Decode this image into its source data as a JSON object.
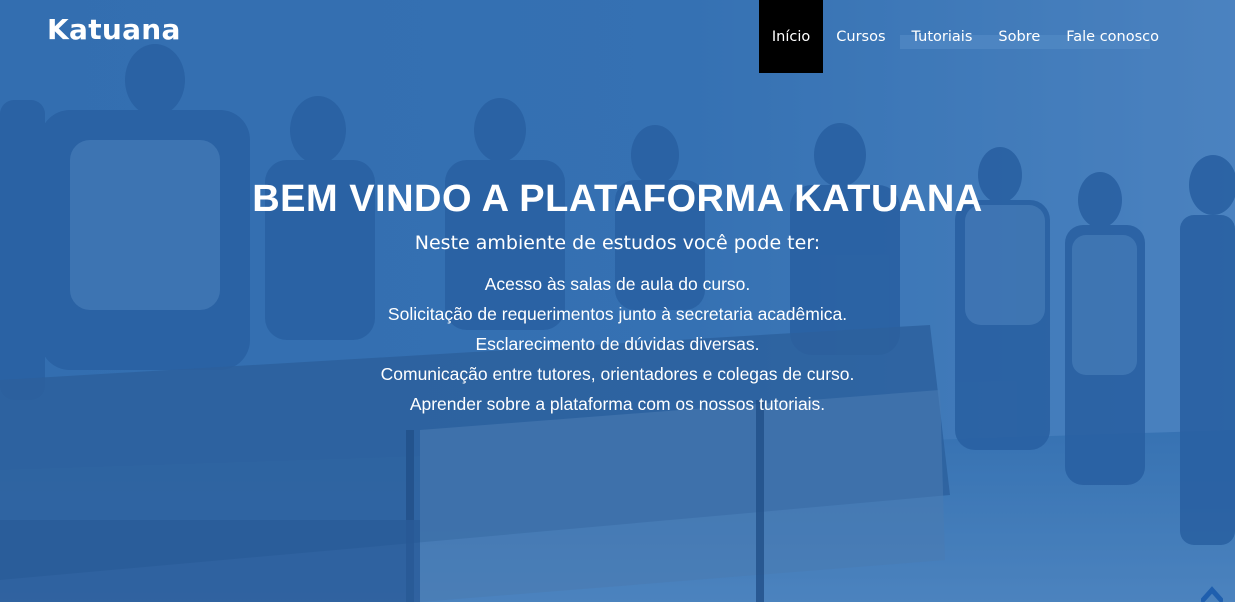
{
  "brand": "Katuana",
  "nav": [
    {
      "label": "Início",
      "active": true
    },
    {
      "label": "Cursos",
      "active": false
    },
    {
      "label": "Tutoriais",
      "active": false
    },
    {
      "label": "Sobre",
      "active": false
    },
    {
      "label": "Fale conosco",
      "active": false
    }
  ],
  "hero": {
    "title": "BEM VINDO A PLATAFORMA KATUANA",
    "subtitle": "Neste ambiente de estudos você pode ter:",
    "features": [
      "Acesso às salas de aula do curso.",
      "Solicitação de requerimentos junto à secretaria acadêmica.",
      "Esclarecimento de dúvidas diversas.",
      "Comunicação entre tutores, orientadores e colegas de curso.",
      "Aprender sobre a plataforma com os nossos tutoriais."
    ]
  },
  "colors": {
    "overlay": "#2d6aae",
    "active_nav": "#000000",
    "text": "#ffffff"
  },
  "icons": {
    "scroll_top": "chevron-up-icon"
  }
}
